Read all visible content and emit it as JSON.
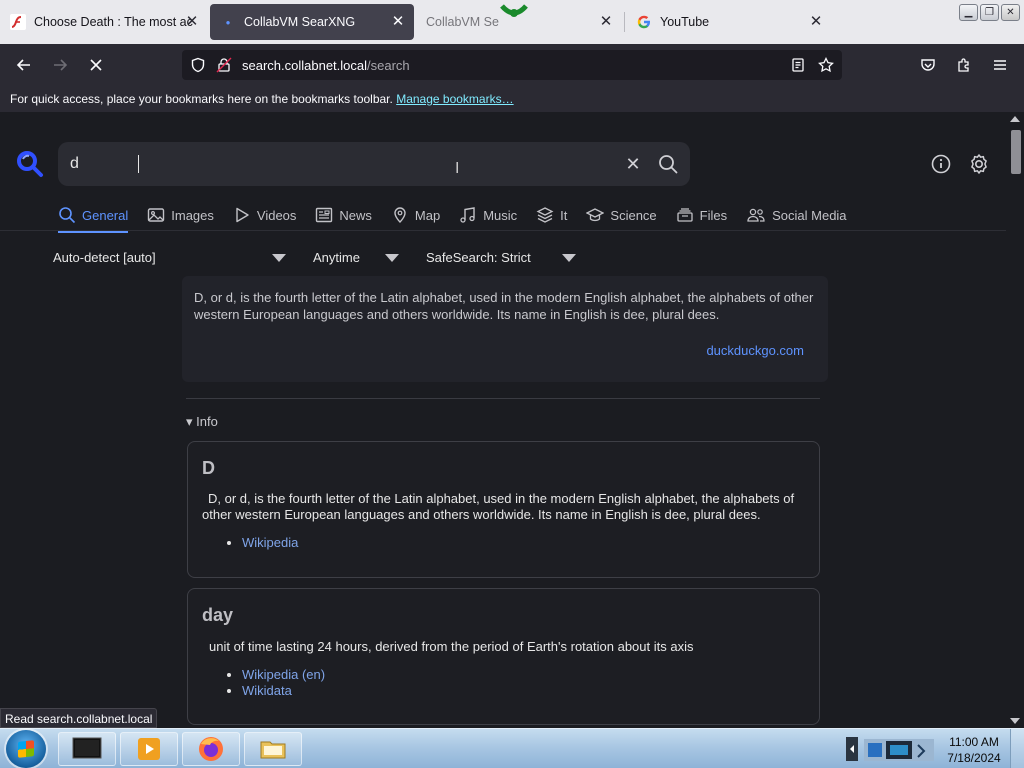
{
  "browser": {
    "tabs": [
      {
        "title": "Choose Death : The most ac",
        "favicon": "flash-icon"
      },
      {
        "title": "CollabVM SearXNG",
        "favicon": "dot-icon",
        "active": true
      },
      {
        "title": "CollabVM Se",
        "favicon": "ghost-icon"
      },
      {
        "title": "YouTube",
        "favicon": "google-icon"
      }
    ],
    "url_host": "search.collabnet.local",
    "url_path": "/search",
    "bookmarks_text": "For quick access, place your bookmarks here on the bookmarks toolbar.",
    "bookmarks_link": "Manage bookmarks…",
    "status_text": "Read search.collabnet.local"
  },
  "search": {
    "query": "d",
    "categories": [
      {
        "label": "General",
        "icon": "search-icon",
        "active": true
      },
      {
        "label": "Images",
        "icon": "image-icon"
      },
      {
        "label": "Videos",
        "icon": "play-icon"
      },
      {
        "label": "News",
        "icon": "newspaper-icon"
      },
      {
        "label": "Map",
        "icon": "map-pin-icon"
      },
      {
        "label": "Music",
        "icon": "music-icon"
      },
      {
        "label": "It",
        "icon": "layers-icon"
      },
      {
        "label": "Science",
        "icon": "school-icon"
      },
      {
        "label": "Files",
        "icon": "files-icon"
      },
      {
        "label": "Social Media",
        "icon": "people-icon"
      }
    ],
    "filters": {
      "language": "Auto-detect [auto]",
      "time": "Anytime",
      "safesearch": "SafeSearch: Strict"
    }
  },
  "answer": {
    "text": "D, or d, is the fourth letter of the Latin alphabet, used in the modern English alphabet, the alphabets of other western European languages and others worldwide. Its name in English is dee, plural dees.",
    "source": "duckduckgo.com"
  },
  "info": {
    "summary": "▾ Info",
    "cards": [
      {
        "title": "D",
        "definition": "D, or d, is the fourth letter of the Latin alphabet, used in the modern English alphabet, the alphabets of other western European languages and others worldwide. Its name in English is dee, plural dees.",
        "links": [
          "Wikipedia"
        ]
      },
      {
        "title": "day",
        "definition": "unit of time lasting 24 hours, derived from the period of Earth's rotation about its axis",
        "links": [
          "Wikipedia (en)",
          "Wikidata"
        ]
      }
    ]
  },
  "taskbar": {
    "time": "11:00 AM",
    "date": "7/18/2024"
  },
  "colors": {
    "accent": "#5e93ff",
    "page_bg": "#1b1c21",
    "taskbar": "#a9c7e3"
  }
}
